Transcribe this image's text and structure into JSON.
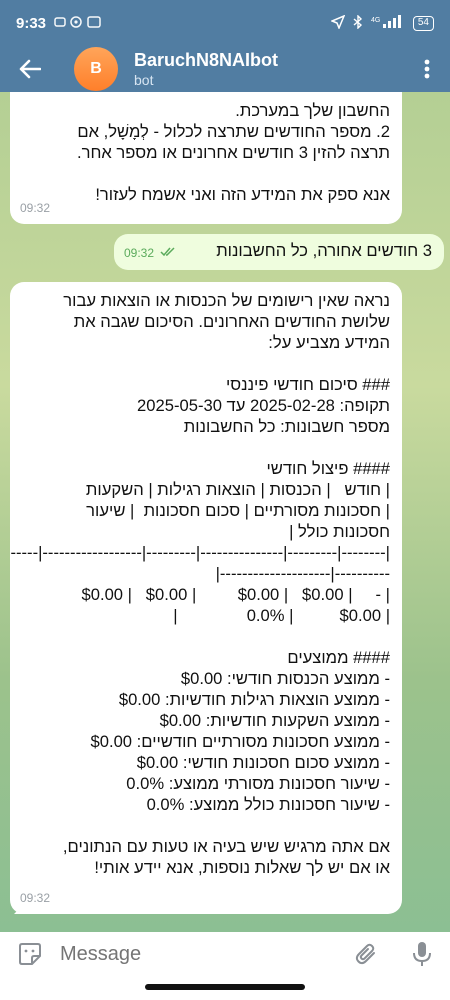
{
  "status": {
    "time": "9:33",
    "battery": "54"
  },
  "header": {
    "back_icon": "arrow-left-icon",
    "avatar_letter": "B",
    "avatar_color": "#ff8c3a",
    "title": "BaruchN8NAIbot",
    "subtitle": "bot"
  },
  "messages": [
    {
      "direction": "in",
      "lines": [
        "החשבון שלך במערכת.",
        "2. מספר החודשים שתרצה לכלול - לְמָשָׁל, אם",
        "תרצה להזין 3 חודשים אחרונים או מספר אחר.",
        "",
        "אנא ספק את המידע הזה ואני אשמח לעזור!"
      ],
      "time": "09:32"
    },
    {
      "direction": "out",
      "text": "3 חודשים אחורה, כל החשבונות",
      "time": "09:32"
    },
    {
      "direction": "in",
      "lines": [
        "נראה שאין רישומים של הכנסות או הוצאות עבור",
        "שלושת החודשים האחרונים. הסיכום שגבה את",
        "המידע מצביע על:",
        "",
        "### סיכום חודשי פיננסי",
        "תקופה: 2025-02-28 עד 2025-05-30",
        "מספר חשבונות: כל החשבונות",
        "",
        "#### פיצול חודשי",
        "| חודש   | הכנסות | הוצאות רגילות | השקעות",
        "| חסכונות מסורתיים | סכום חסכונות  | שיעור",
        "חסכונות כולל |",
        "|--------|---------|---------------|---------|------------------|-----",
        "----------|--------------------|",
        "| -     | $0.00   | $0.00         | $0.00   | $0.00",
        "| $0.00          | 0.0%               |",
        "",
        "#### ממוצעים",
        "- ממוצע הכנסות חודשי: $0.00",
        "- ממוצע הוצאות רגילות חודשיות: $0.00",
        "- ממוצע השקעות חודשיות: $0.00",
        "- ממוצע חסכונות מסורתיים חודשיים: $0.00",
        "- ממוצע סכום חסכונות חודשי: $0.00",
        "- שיעור חסכונות מסורתי ממוצע: 0.0%",
        "- שיעור חסכונות כולל ממוצע: 0.0%",
        "",
        "אם אתה מרגיש שיש בעיה או טעות עם הנתונים,",
        "או אם יש לך שאלות נוספות, אנא יידע אותי!"
      ],
      "time": "09:32"
    }
  ],
  "input": {
    "placeholder": "Message",
    "emoji_icon": "sticker-smile-icon",
    "attach_icon": "paperclip-icon",
    "mic_icon": "microphone-icon"
  },
  "colors": {
    "header_bg": "#517da2",
    "outgoing_bubble": "#effdde",
    "read_check": "#5bab5c"
  }
}
